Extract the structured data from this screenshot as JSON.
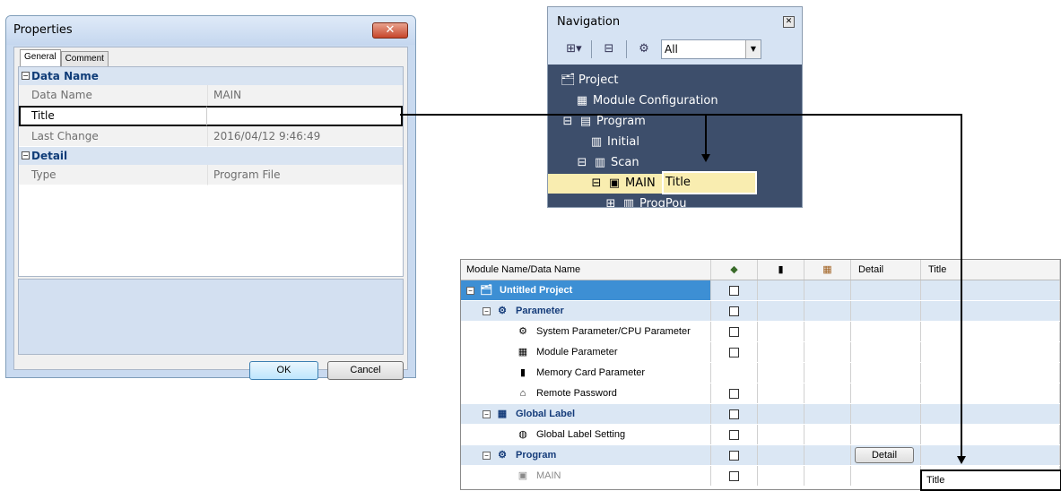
{
  "properties": {
    "title": "Properties",
    "close_glyph": "✕",
    "tabs": [
      "General",
      "Comment"
    ],
    "categories": {
      "data_name": "Data Name",
      "detail": "Detail"
    },
    "rows": [
      {
        "key": "Data Name",
        "value": "MAIN"
      },
      {
        "key": "Title",
        "value": ""
      },
      {
        "key": "Last Change",
        "value": "2016/04/12 9:46:49"
      },
      {
        "key": "Type",
        "value": "Program File"
      }
    ],
    "ok_label": "OK",
    "cancel_label": "Cancel"
  },
  "navigation": {
    "title": "Navigation",
    "filter_value": "All",
    "tree": [
      {
        "label": "Project",
        "icon": "project-icon"
      },
      {
        "label": "Module Configuration",
        "icon": "module-config-icon"
      },
      {
        "label": "Program",
        "icon": "program-icon"
      },
      {
        "label": "Initial",
        "icon": "initial-icon"
      },
      {
        "label": "Scan",
        "icon": "scan-icon"
      },
      {
        "label": "MAIN",
        "icon": "program-file-icon"
      },
      {
        "label": "ProgPou",
        "icon": "pou-icon"
      }
    ],
    "title_edit": "Title"
  },
  "module_table": {
    "headers": {
      "name": "Module Name/Data Name",
      "detail": "Detail",
      "title": "Title"
    },
    "rows": [
      {
        "name": "Untitled Project"
      },
      {
        "name": "Parameter"
      },
      {
        "name": "System Parameter/CPU Parameter"
      },
      {
        "name": "Module Parameter"
      },
      {
        "name": "Memory Card Parameter"
      },
      {
        "name": "Remote Password"
      },
      {
        "name": "Global Label"
      },
      {
        "name": "Global Label Setting"
      },
      {
        "name": "Program"
      },
      {
        "name": "MAIN"
      }
    ],
    "detail_button": "Detail",
    "title_value": "Title"
  }
}
